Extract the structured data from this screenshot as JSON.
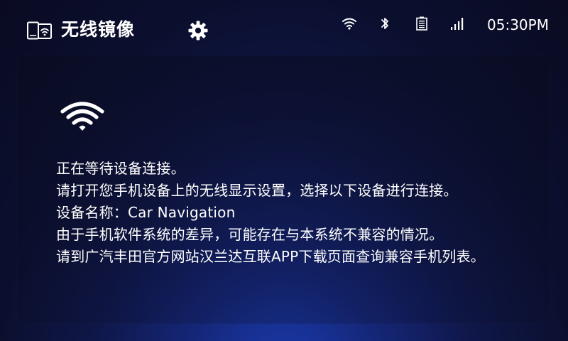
{
  "header": {
    "title": "无线镜像",
    "app_icon": "phone-wireless-icon",
    "settings_icon": "gear-icon"
  },
  "status": {
    "wifi_icon": "wifi-icon",
    "bluetooth_icon": "bluetooth-icon",
    "battery_icon": "battery-icon",
    "signal_icon": "cellular-signal-icon",
    "time": "05:30PM"
  },
  "main": {
    "wifi_icon": "wifi-icon",
    "lines": {
      "waiting": "正在等待设备连接。",
      "instruction": "请打开您手机设备上的无线显示设置，选择以下设备进行连接。",
      "device_label": "设备名称：",
      "device_name": "Car Navigation",
      "compatibility": "由于手机软件系统的差异，可能存在与本系统不兼容的情况。",
      "query": "请到广汽丰田官方网站汉兰达互联APP下载页面查询兼容手机列表。"
    }
  },
  "colors": {
    "background_dark": "#0b0f2e",
    "background_glow": "#1a3fb8",
    "text": "#ffffff"
  }
}
